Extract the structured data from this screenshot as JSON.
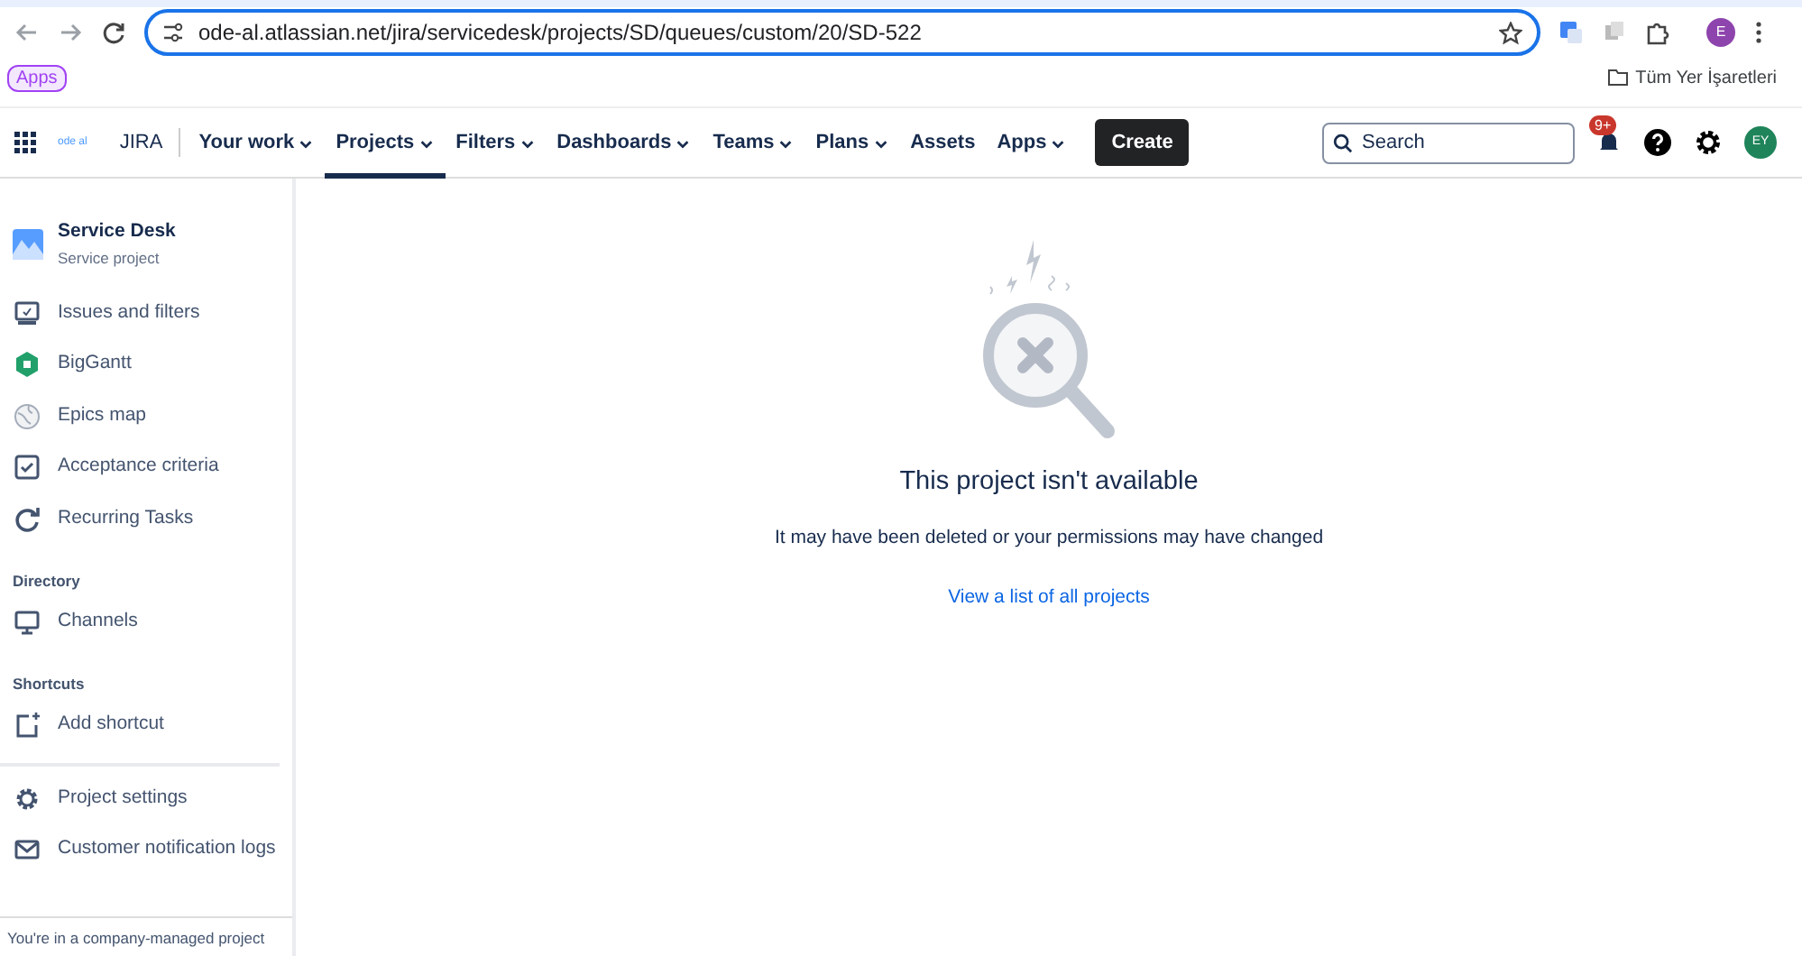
{
  "browser": {
    "url": "ode-al.atlassian.net/jira/servicedesk/projects/SD/queues/custom/20/SD-522",
    "profile": "E",
    "bookmarks": [
      {
        "label": "Apps",
        "kind": "group"
      },
      {
        "label": "Tüm Yer İşaretleri",
        "kind": "folder"
      }
    ]
  },
  "topnav": {
    "logo": "ode al",
    "product": "JIRA",
    "items": [
      {
        "label": "Your work",
        "menu": true,
        "selected": false
      },
      {
        "label": "Projects",
        "menu": true,
        "selected": true
      },
      {
        "label": "Filters",
        "menu": true,
        "selected": false
      },
      {
        "label": "Dashboards",
        "menu": true,
        "selected": false
      },
      {
        "label": "Teams",
        "menu": true,
        "selected": false
      },
      {
        "label": "Plans",
        "menu": true,
        "selected": false
      },
      {
        "label": "Assets",
        "menu": false,
        "selected": false
      },
      {
        "label": "Apps",
        "menu": true,
        "selected": false
      }
    ],
    "create": "Create",
    "search": {
      "placeholder": "Search"
    },
    "notifications": "9+",
    "avatar": "EY"
  },
  "sidebar": {
    "project": {
      "name": "Service Desk",
      "type": "Service project"
    },
    "sections": [
      {
        "items": [
          {
            "label": "Issues and filters",
            "kind": "board"
          },
          {
            "label": "BigGantt",
            "kind": "gantt"
          },
          {
            "label": "Epics map",
            "kind": "globe"
          },
          {
            "label": "Acceptance criteria",
            "kind": "check"
          },
          {
            "label": "Recurring Tasks",
            "kind": "refresh"
          }
        ]
      },
      {
        "heading": "Directory",
        "items": [
          {
            "label": "Channels",
            "kind": "monitor"
          }
        ]
      },
      {
        "heading": "Shortcuts",
        "items": [
          {
            "label": "Add shortcut",
            "kind": "add"
          }
        ]
      },
      {
        "divider": true,
        "items": [
          {
            "label": "Project settings",
            "kind": "gear"
          },
          {
            "label": "Customer notification logs",
            "kind": "mail"
          }
        ]
      }
    ],
    "footer": "You're in a company-managed project"
  },
  "main": {
    "title": "This project isn't available",
    "message": "It may have been deleted or your permissions may have changed",
    "link": "View a list of all projects"
  }
}
